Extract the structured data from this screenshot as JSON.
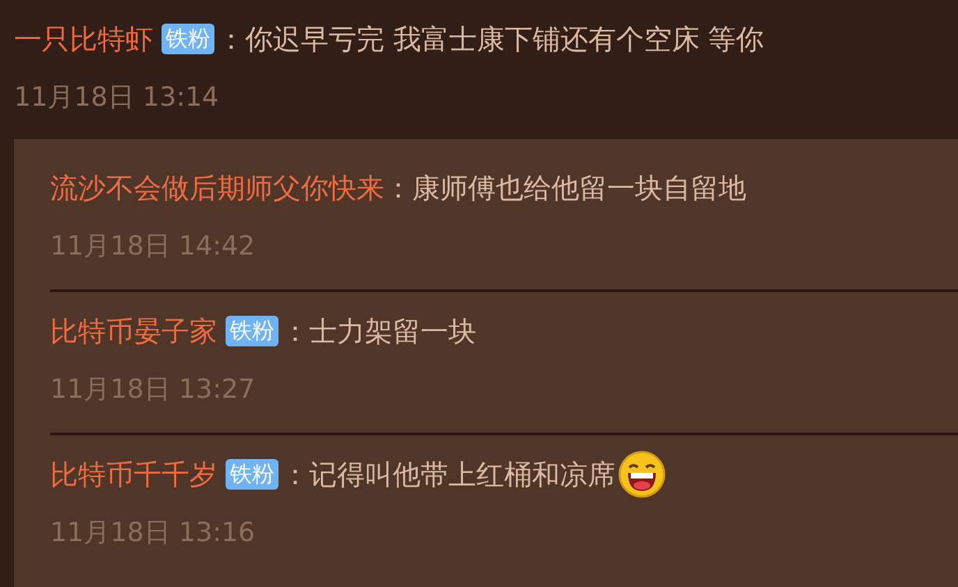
{
  "comment": {
    "author": "一只比特虾",
    "badge": "铁粉",
    "text": "：你迟早亏完 我富士康下铺还有个空床  等你",
    "time": "11月18日 13:14",
    "emoji": false
  },
  "replies": [
    {
      "author": "流沙不会做后期师父你快来",
      "text": "：康师傅也给他留一块自留地",
      "time": "11月18日 14:42",
      "emoji": false
    },
    {
      "author": "比特币晏子家",
      "badge": "铁粉",
      "text": "：士力架留一块",
      "time": "11月18日 13:27",
      "emoji": false
    },
    {
      "author": "比特币千千岁",
      "badge": "铁粉",
      "text": "：记得叫他带上红桶和凉席",
      "time": "11月18日 13:16",
      "emoji": true
    }
  ]
}
